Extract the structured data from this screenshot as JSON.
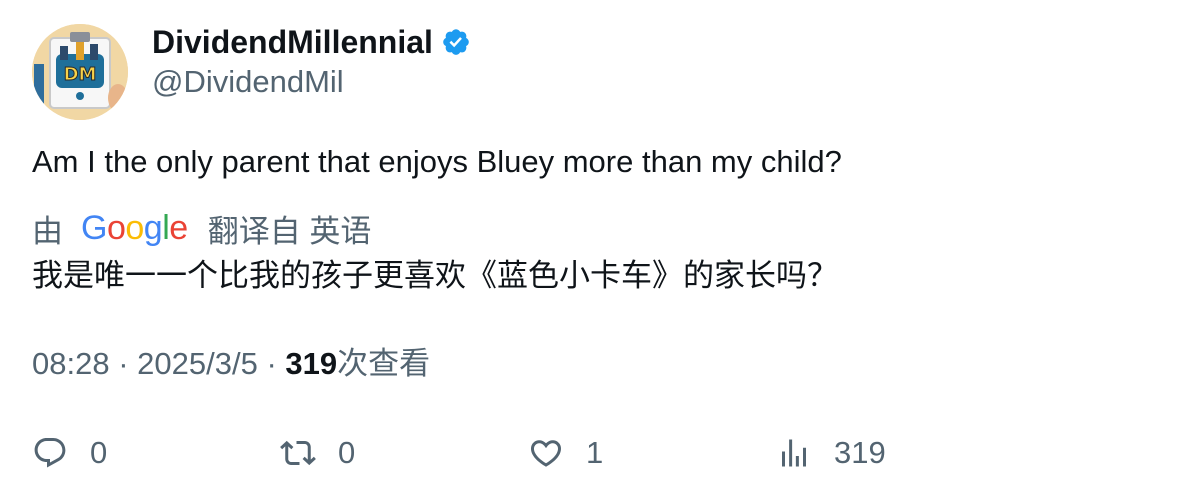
{
  "user": {
    "display_name": "DividendMillennial",
    "handle": "@DividendMil",
    "avatar_text": "DM",
    "verified": true
  },
  "tweet": {
    "text": "Am I the only parent that enjoys Bluey more than my child?"
  },
  "translation": {
    "by_label": "由",
    "provider": "Google",
    "translated_from_label": "翻译自 英语",
    "text": "我是唯一一个比我的孩子更喜欢《蓝色小卡车》的家长吗？"
  },
  "meta": {
    "time": "08:28",
    "separator": "·",
    "date": "2025/3/5",
    "views_count": "319",
    "views_label": "次查看"
  },
  "actions": {
    "replies": "0",
    "retweets": "0",
    "likes": "1",
    "views": "319"
  },
  "colors": {
    "verified_badge": "#1d9bf0",
    "text_primary": "#0f1419",
    "text_secondary": "#536471",
    "google_blue": "#4285f4",
    "google_red": "#ea4335",
    "google_yellow": "#fbbc05",
    "google_green": "#34a853"
  },
  "icons": {
    "reply": "reply-icon",
    "retweet": "retweet-icon",
    "like": "heart-icon",
    "views": "views-chart-icon",
    "verified": "verified-badge-icon"
  }
}
